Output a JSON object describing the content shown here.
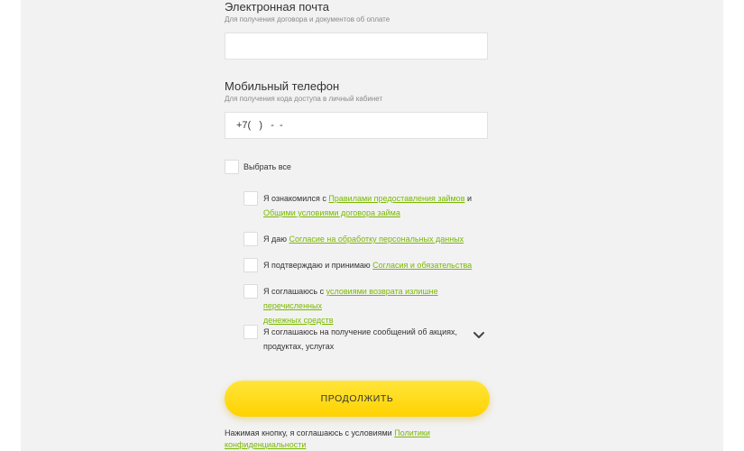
{
  "email": {
    "title": "Электронная почта",
    "hint": "Для получения договора и документов об оплате",
    "value": ""
  },
  "phone": {
    "title": "Мобильный телефон",
    "hint": "Для получения кода доступа в личный кабинет",
    "value": "+7(   )   -  -"
  },
  "select_all": {
    "label": "Выбрать все",
    "checked": false
  },
  "consents": [
    {
      "pre": "Я ознакомился с ",
      "link1": "Правилами предоставления займов",
      "mid": " и",
      "link2": "Общими условиями договора займа",
      "checked": false
    },
    {
      "pre": "Я даю ",
      "link1": "Согласие на обработку персональных данных",
      "checked": false
    },
    {
      "pre": "Я подтверждаю и принимаю ",
      "link1": "Согласия и обязательства",
      "checked": false
    },
    {
      "pre": "Я соглашаюсь с ",
      "link1": "условиями возврата излишне перечисленных",
      "link2": "денежных средств",
      "checked": false
    },
    {
      "line1": "Я соглашаюсь на получение сообщений об акциях,",
      "line2": "продуктах, услугах",
      "checked": false
    }
  ],
  "expand_icon": "chevron-down-icon",
  "submit": {
    "label": "ПРОДОЛЖИТЬ"
  },
  "footer": {
    "pre": "Нажимая кнопку, я соглашаюсь с условиями ",
    "link1": "Политики",
    "link2": "конфиденциальности"
  },
  "colors": {
    "link": "#7ab800",
    "button": "#ffd200",
    "panel": "#f2f2f2"
  }
}
